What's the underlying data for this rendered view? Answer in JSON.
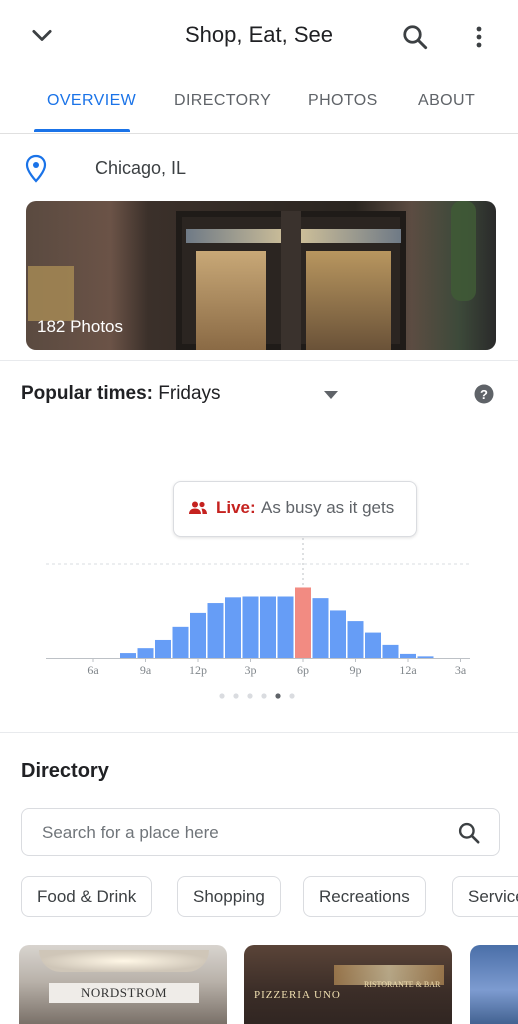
{
  "header": {
    "title": "Shop, Eat, See"
  },
  "tabs": [
    {
      "label": "OVERVIEW",
      "active": true
    },
    {
      "label": "DIRECTORY",
      "active": false
    },
    {
      "label": "PHOTOS",
      "active": false
    },
    {
      "label": "ABOUT",
      "active": false
    }
  ],
  "location": {
    "text": "Chicago, IL"
  },
  "photos": {
    "count_label": "182 Photos"
  },
  "popular_times": {
    "label": "Popular times:",
    "day": "Fridays",
    "live_label": "Live:",
    "live_text": "As busy as it gets",
    "dots_total": 6,
    "dots_active_index": 4
  },
  "chart_data": {
    "type": "bar",
    "x_tick_labels": [
      "6a",
      "9a",
      "12p",
      "3p",
      "6p",
      "9p",
      "12a",
      "3a"
    ],
    "hours": [
      "4a",
      "5a",
      "6a",
      "7a",
      "8a",
      "9a",
      "10a",
      "11a",
      "12p",
      "1p",
      "2p",
      "3p",
      "4p",
      "5p",
      "6p",
      "7p",
      "8p",
      "9p",
      "10p",
      "11p",
      "12a",
      "1a",
      "2a",
      "3a"
    ],
    "values": [
      0,
      0,
      0,
      0,
      0.06,
      0.12,
      0.22,
      0.38,
      0.55,
      0.67,
      0.74,
      0.75,
      0.75,
      0.75,
      0.86,
      0.73,
      0.58,
      0.45,
      0.31,
      0.16,
      0.05,
      0.02,
      0,
      0
    ],
    "live_index": 14,
    "colors": {
      "bar": "#669df6",
      "live": "#f28b82"
    }
  },
  "directory": {
    "title": "Directory",
    "search_placeholder": "Search for a place here",
    "chips": [
      "Food & Drink",
      "Shopping",
      "Recreations",
      "Services"
    ],
    "thumbnails": [
      {
        "sign": "NORDSTROM"
      },
      {
        "sign": "PIZZERIA UNO",
        "sign2": "RISTORANTE & BAR"
      },
      {
        "sign": ""
      }
    ]
  },
  "colors": {
    "accent": "#1a73e8",
    "live_red": "#c5221f"
  }
}
